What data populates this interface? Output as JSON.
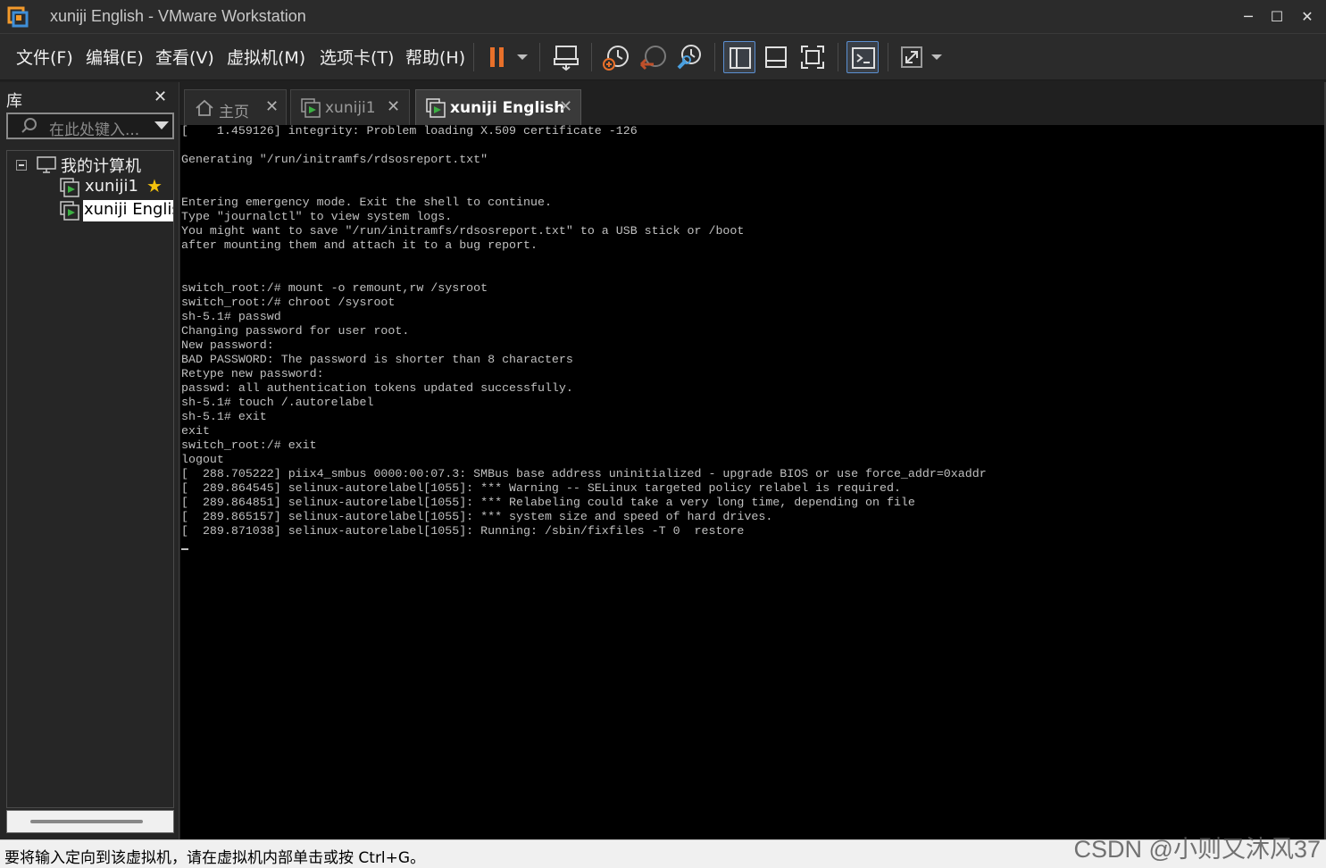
{
  "window": {
    "title": "xuniji English - VMware Workstation",
    "minimize": "─",
    "maximize": "☐",
    "close": "✕"
  },
  "menu": {
    "items": [
      "文件(F)",
      "编辑(E)",
      "查看(V)",
      "虚拟机(M)",
      "选项卡(T)",
      "帮助(H)"
    ]
  },
  "toolbar": {
    "icons": [
      "pause-icon",
      "send-ctrl-alt-del-icon",
      "snapshot-icon",
      "revert-snapshot-icon",
      "snapshot-manager-icon",
      "library-view-icon",
      "thumbnail-view-icon",
      "fullscreen-icon",
      "console-view-icon",
      "stretch-icon"
    ],
    "accent": "#e8702a"
  },
  "sidebar": {
    "title": "库",
    "close": "✕",
    "search_placeholder": "在此处键入...",
    "tree": {
      "root": "我的计算机",
      "items": [
        {
          "label": "xuniji1",
          "favorite": true
        },
        {
          "label": "xuniji English",
          "selected": true
        }
      ]
    }
  },
  "tabs": [
    {
      "label": "主页",
      "icon": "home-icon",
      "active": false
    },
    {
      "label": "xuniji1",
      "icon": "vm-icon",
      "active": false
    },
    {
      "label": "xuniji English",
      "icon": "vm-icon",
      "active": true
    }
  ],
  "tab_close": "✕",
  "console": {
    "text": "[    1.459126] integrity: Problem loading X.509 certificate -126\n\nGenerating \"/run/initramfs/rdsosreport.txt\"\n\n\nEntering emergency mode. Exit the shell to continue.\nType \"journalctl\" to view system logs.\nYou might want to save \"/run/initramfs/rdsosreport.txt\" to a USB stick or /boot\nafter mounting them and attach it to a bug report.\n\n\nswitch_root:/# mount -o remount,rw /sysroot\nswitch_root:/# chroot /sysroot\nsh-5.1# passwd\nChanging password for user root.\nNew password:\nBAD PASSWORD: The password is shorter than 8 characters\nRetype new password:\npasswd: all authentication tokens updated successfully.\nsh-5.1# touch /.autorelabel\nsh-5.1# exit\nexit\nswitch_root:/# exit\nlogout\n[  288.705222] piix4_smbus 0000:00:07.3: SMBus base address uninitialized - upgrade BIOS or use force_addr=0xaddr\n[  289.864545] selinux-autorelabel[1055]: *** Warning -- SELinux targeted policy relabel is required.\n[  289.864851] selinux-autorelabel[1055]: *** Relabeling could take a very long time, depending on file\n[  289.865157] selinux-autorelabel[1055]: *** system size and speed of hard drives.\n[  289.871038] selinux-autorelabel[1055]: Running: /sbin/fixfiles -T 0  restore"
  },
  "status": {
    "text": "要将输入定向到该虚拟机，请在虚拟机内部单击或按 Ctrl+G。",
    "watermark": "CSDN @小则又沐风37"
  }
}
